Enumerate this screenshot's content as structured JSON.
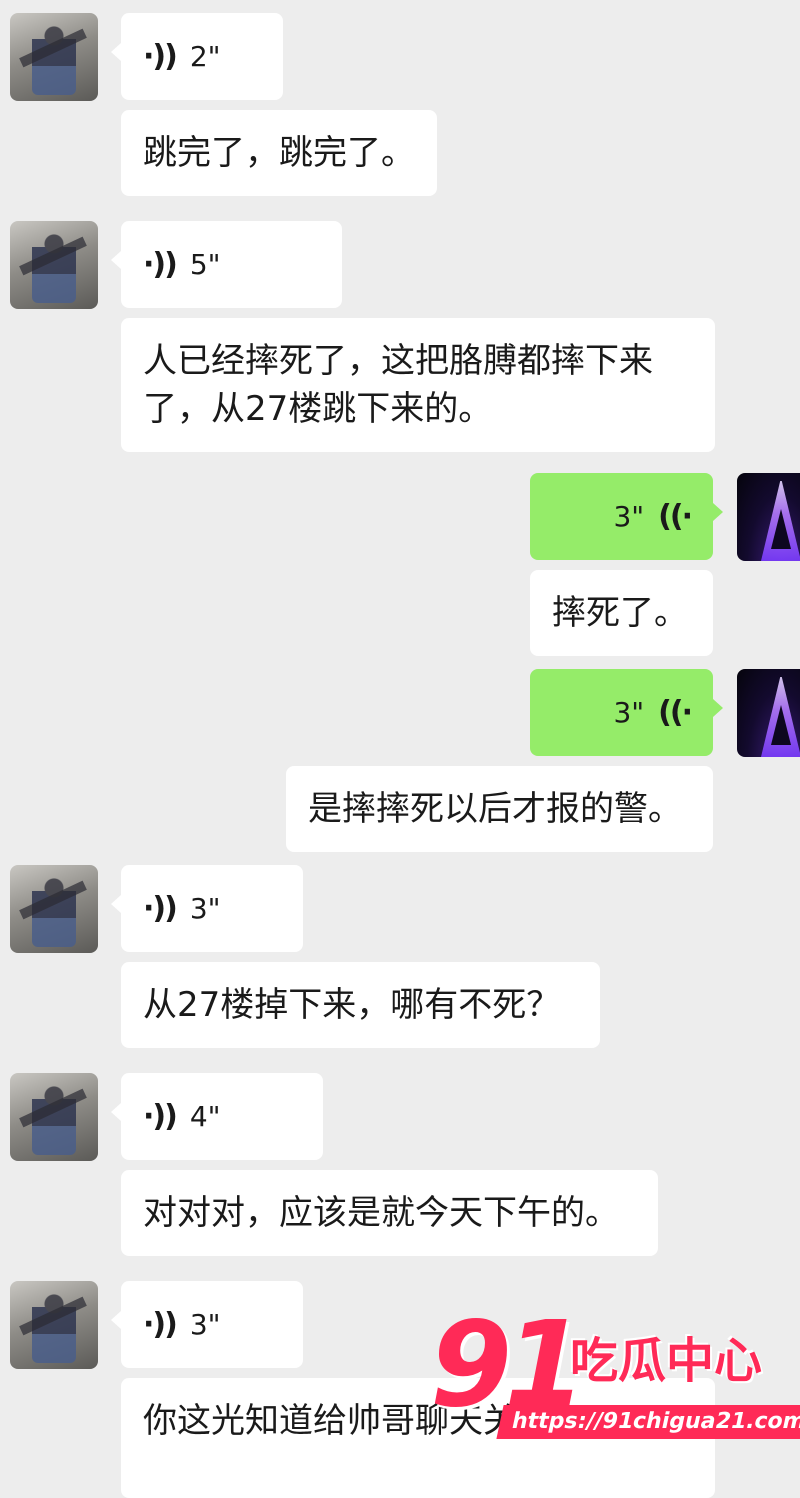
{
  "messages": [
    {
      "side": "left",
      "type": "voice",
      "duration": "2\""
    },
    {
      "side": "left",
      "type": "text",
      "text": "跳完了，跳完了。"
    },
    {
      "side": "left",
      "type": "voice",
      "duration": "5\""
    },
    {
      "side": "left",
      "type": "text",
      "text": "人已经摔死了，这把胳膊都摔下来了，从27楼跳下来的。"
    },
    {
      "side": "right",
      "type": "voice",
      "duration": "3\""
    },
    {
      "side": "right",
      "type": "text",
      "text": "摔死了。"
    },
    {
      "side": "right",
      "type": "voice",
      "duration": "3\""
    },
    {
      "side": "right",
      "type": "text",
      "text": "是摔摔死以后才报的警。"
    },
    {
      "side": "left",
      "type": "voice",
      "duration": "3\""
    },
    {
      "side": "left",
      "type": "text",
      "text": "从27楼掉下来，哪有不死？"
    },
    {
      "side": "left",
      "type": "voice",
      "duration": "4\""
    },
    {
      "side": "left",
      "type": "text",
      "text": "对对对，应该是就今天下午的。"
    },
    {
      "side": "left",
      "type": "voice",
      "duration": "3\""
    },
    {
      "side": "left",
      "type": "text",
      "text": "你这光知道给帅哥聊天关注"
    }
  ],
  "icons": {
    "voice_left": "voice-wave-icon",
    "voice_right": "voice-wave-icon"
  },
  "colors": {
    "background": "#ededed",
    "bubble_in": "#ffffff",
    "bubble_out": "#95ec69",
    "watermark": "#ff2a57"
  },
  "watermark": {
    "number": "91",
    "name": "吃瓜中心",
    "url": "https://91chigua21.com"
  }
}
